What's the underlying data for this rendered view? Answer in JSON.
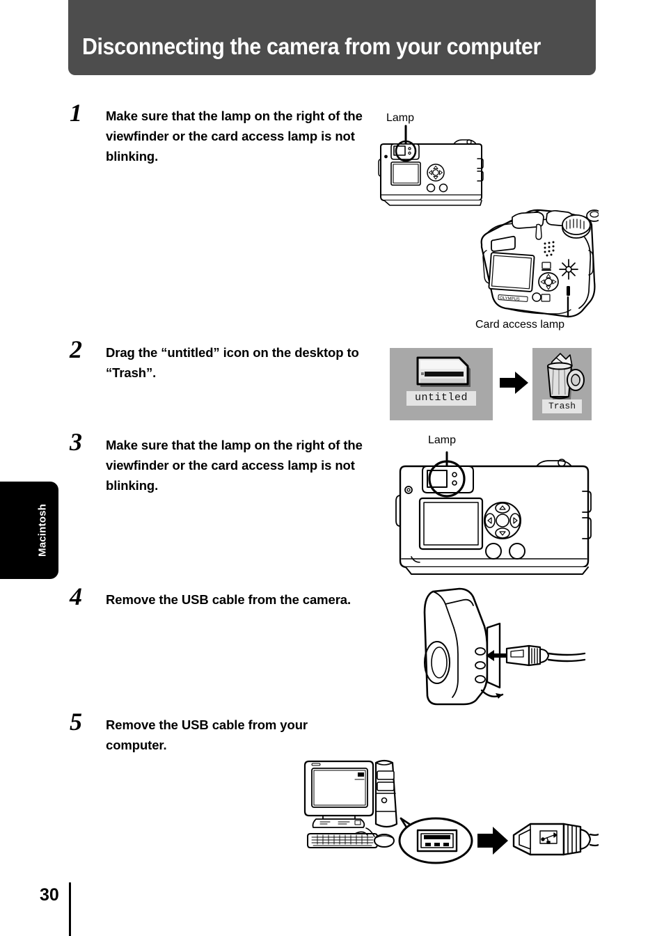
{
  "header": {
    "title": "Disconnecting the camera from your computer",
    "background_color": "#4d4d4d",
    "text_color": "#ffffff"
  },
  "side_tab": {
    "label": "Macintosh",
    "background_color": "#000000",
    "text_color": "#ffffff"
  },
  "steps": [
    {
      "number": "1",
      "text": "Make sure that the lamp on the right of the viewfinder or the card access lamp is not blinking."
    },
    {
      "number": "2",
      "text": "Drag the “untitled” icon on the desktop to “Trash”."
    },
    {
      "number": "3",
      "text": "Make sure that the lamp on the right of the viewfinder or the card access lamp is not blinking."
    },
    {
      "number": "4",
      "text": "Remove the USB cable from the camera."
    },
    {
      "number": "5",
      "text": "Remove the USB cable from your computer."
    }
  ],
  "figures": {
    "step1": {
      "lamp_label": "Lamp",
      "card_access_label": "Card access lamp",
      "description": "Camera back view with lamp circled, and three-quarter view of camera with card access lamp"
    },
    "step2": {
      "drive_icon_caption": "untitled",
      "trash_icon_caption": "Trash",
      "icon_background_color": "#a8a8a8",
      "caption_background_color": "#e4e4e4",
      "description": "Macintosh desktop drive icon dragged to Trash icon"
    },
    "step3": {
      "lamp_label": "Lamp",
      "description": "Camera back view with lamp circled"
    },
    "step4": {
      "description": "USB cable connector being removed from camera side port"
    },
    "step5": {
      "description": "Desktop computer with monitor, tower, keyboard and mouse; callout of USB port with USB connector"
    }
  },
  "footer": {
    "page_number": "30"
  }
}
